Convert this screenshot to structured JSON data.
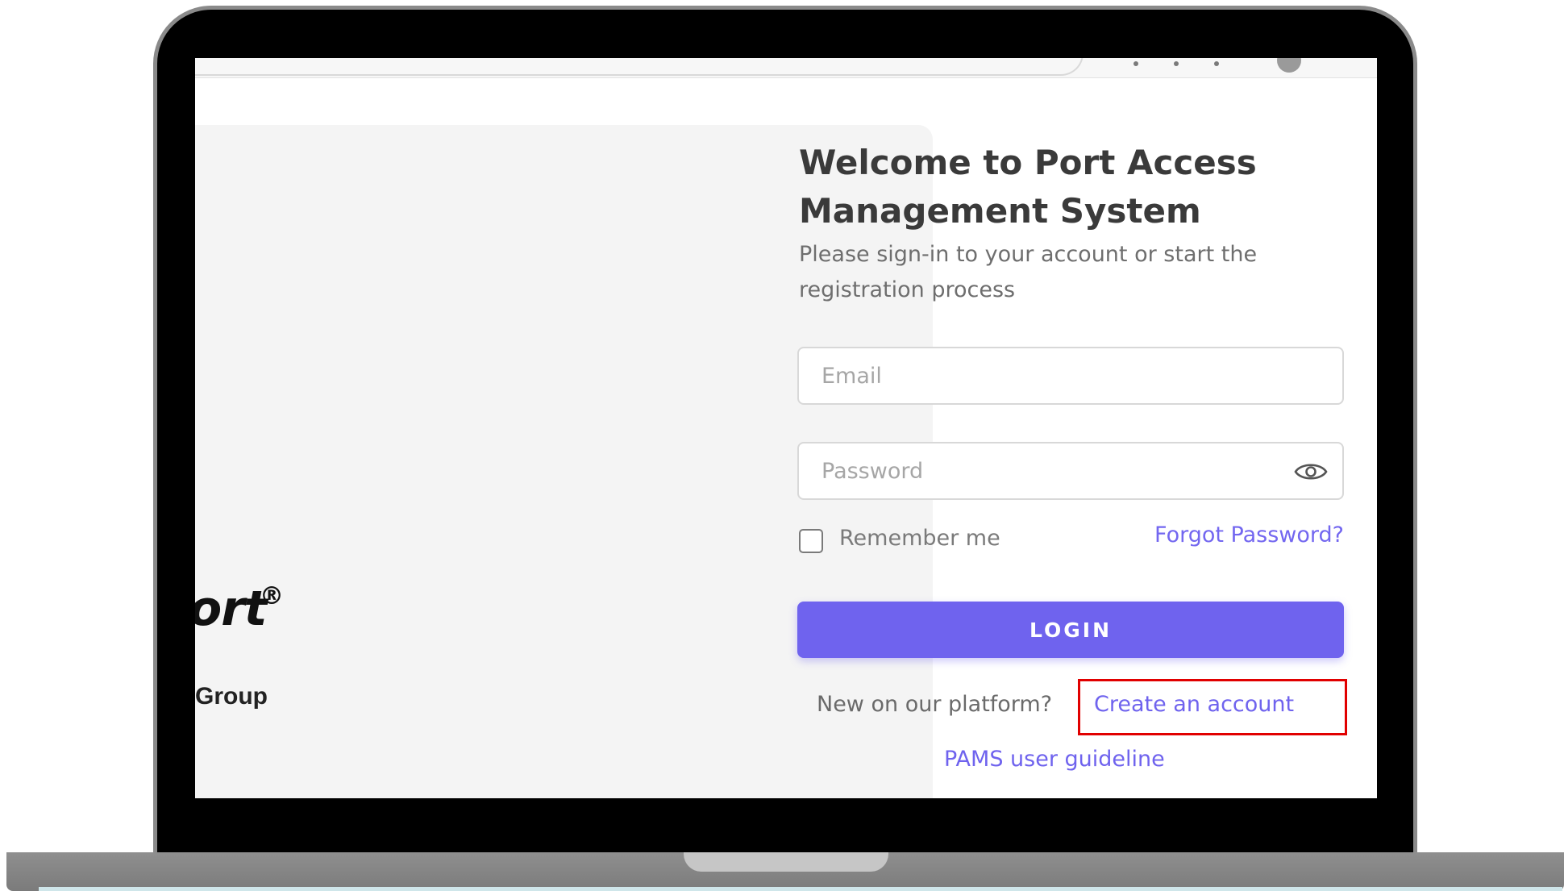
{
  "login": {
    "title": "Welcome to Port Access Management System",
    "subtitle": "Please sign-in to your account or start the registration process",
    "email_placeholder": "Email",
    "password_placeholder": "Password",
    "password_toggle_icon": "eye-icon",
    "remember_label": "Remember me",
    "remember_checked": false,
    "forgot_link": "Forgot Password?",
    "login_button": "LOGIN",
    "signup_prompt": "New on our platform?",
    "create_account_link": "Create an account",
    "guideline_link": "PAMS user guideline"
  },
  "brand_panel": {
    "logo_fragment": "ort",
    "logo_registered": "®",
    "group_fragment": "Group"
  },
  "colors": {
    "accent": "#7367f0",
    "highlight_box": "#e10000",
    "title_text": "#3a3a3a",
    "panel_bg": "#f4f4f4"
  }
}
